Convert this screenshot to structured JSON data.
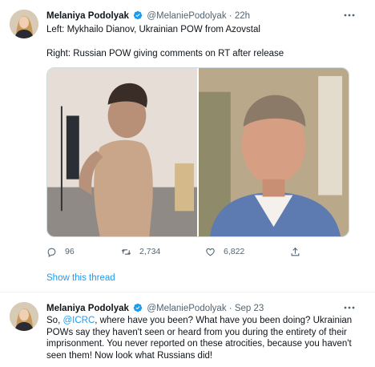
{
  "tweets": [
    {
      "author_name": "Melaniya Podolyak",
      "handle": "@MelaniePodolyak",
      "separator": "·",
      "time": "22h",
      "line1": "Left: Mykhailo Dianov, Ukrainian POW from Azovstal",
      "line2": "Right: Russian POW giving comments on RT after release",
      "replies": "96",
      "retweets": "2,734",
      "likes": "6,822"
    },
    {
      "author_name": "Melaniya Podolyak",
      "handle": "@MelaniePodolyak",
      "separator": "·",
      "time": "Sep 23",
      "text_prefix": "So, ",
      "mention": "@ICRC",
      "text_rest": ", where have you been? What have you been doing? Ukrainian POWs say they haven't seen or heard from you during the entirety of their imprisonment. You never reported on these atrocities, because you haven't seen them! Now look what Russians did!"
    }
  ],
  "show_thread_label": "Show this thread",
  "colors": {
    "accent": "#1d9bf0",
    "muted_text": "#536471",
    "text": "#0f1419",
    "divider": "#eff3f4"
  },
  "icons": [
    "more-icon",
    "verified-badge-icon",
    "reply-icon",
    "retweet-icon",
    "like-icon",
    "share-icon"
  ]
}
